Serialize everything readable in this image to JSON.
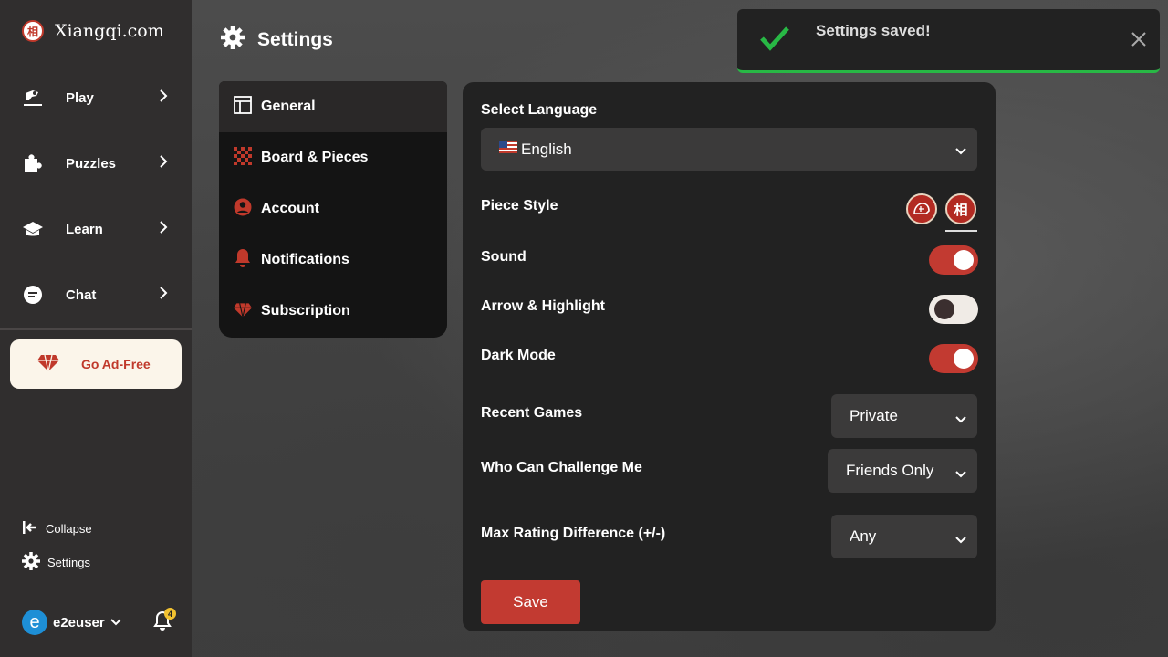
{
  "app": {
    "name": "Xiangqi.com",
    "logo_char": "相"
  },
  "sidebar": {
    "items": [
      {
        "label": "Play",
        "icon": "play-hand-icon"
      },
      {
        "label": "Puzzles",
        "icon": "puzzle-icon"
      },
      {
        "label": "Learn",
        "icon": "graduation-cap-icon"
      },
      {
        "label": "Chat",
        "icon": "chat-icon"
      }
    ],
    "adfree_label": "Go Ad-Free",
    "collapse_label": "Collapse",
    "settings_label": "Settings",
    "user": {
      "initial": "e",
      "name": "e2euser"
    },
    "notifications_count": "4"
  },
  "header": {
    "title": "Settings"
  },
  "settings_nav": [
    {
      "label": "General",
      "icon": "layout-icon",
      "active": true
    },
    {
      "label": "Board & Pieces",
      "icon": "checkerboard-icon",
      "active": false
    },
    {
      "label": "Account",
      "icon": "user-circle-icon",
      "active": false
    },
    {
      "label": "Notifications",
      "icon": "bell-icon",
      "active": false
    },
    {
      "label": "Subscription",
      "icon": "diamond-icon",
      "active": false
    }
  ],
  "general": {
    "language_label": "Select Language",
    "language_value": "English",
    "piece_style_label": "Piece Style",
    "piece_style_options": [
      "traditional-piece-icon",
      "相"
    ],
    "sound_label": "Sound",
    "sound_on": true,
    "arrow_label": "Arrow & Highlight",
    "arrow_on": false,
    "dark_mode_label": "Dark Mode",
    "dark_mode_on": true,
    "recent_games_label": "Recent Games",
    "recent_games_value": "Private",
    "challenge_label": "Who Can Challenge Me",
    "challenge_value": "Friends Only",
    "rating_label": "Max Rating Difference (+/-)",
    "rating_value": "Any",
    "save_label": "Save"
  },
  "toast": {
    "message": "Settings saved!",
    "status_color": "#28b845"
  },
  "colors": {
    "accent": "#c23a31",
    "sidebar_bg": "#302e2e",
    "panel_bg": "#222222"
  }
}
